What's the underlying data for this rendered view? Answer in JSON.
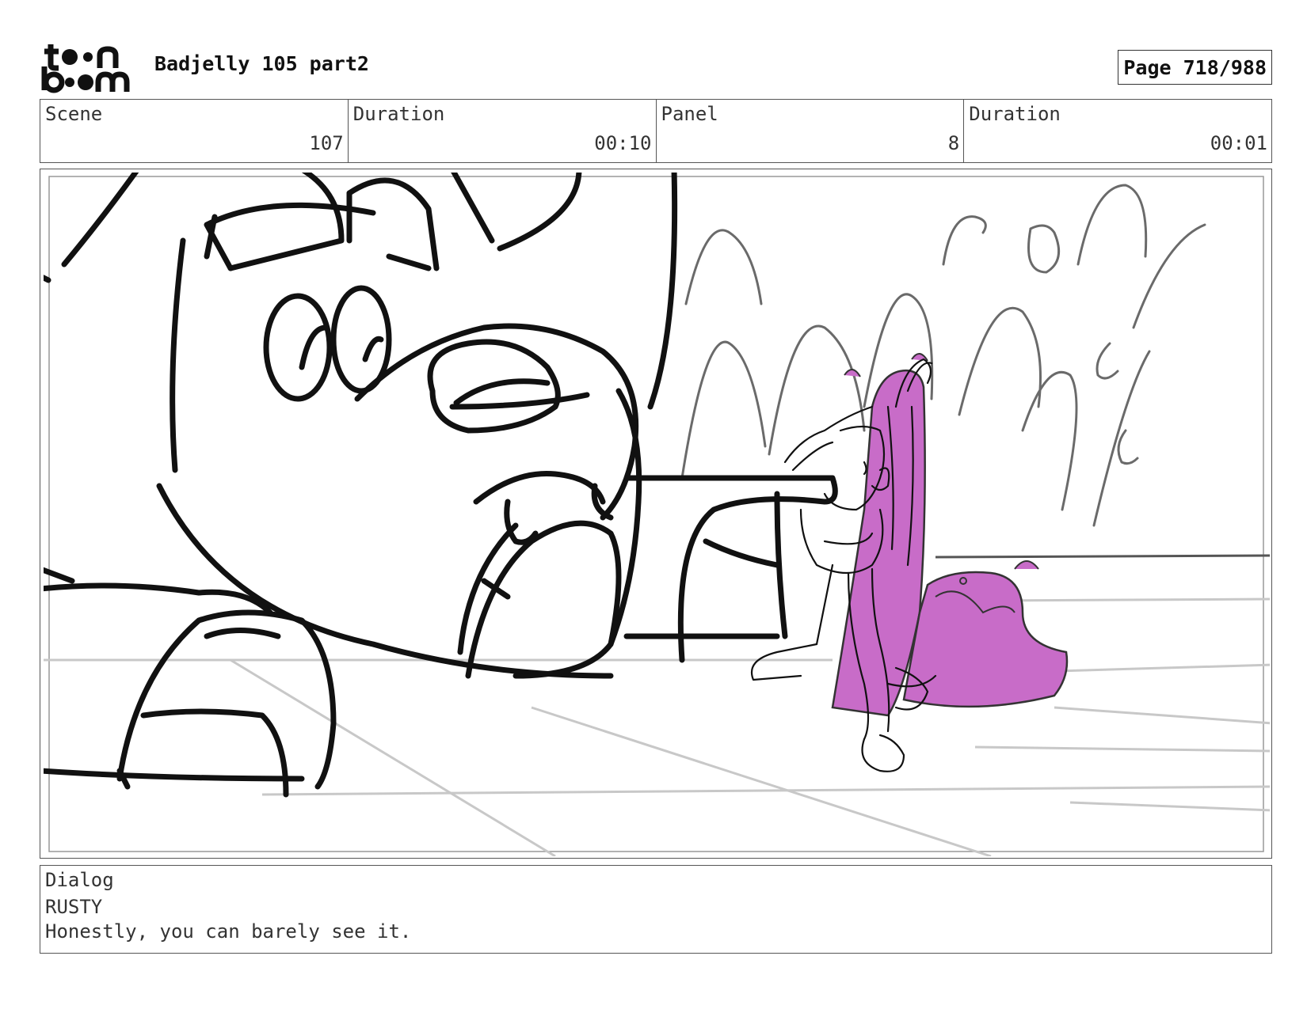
{
  "header": {
    "project_title": "Badjelly 105 part2",
    "page_label": "Page 718/988"
  },
  "info": {
    "scene": {
      "label": "Scene",
      "value": "107"
    },
    "scene_duration": {
      "label": "Duration",
      "value": "00:10"
    },
    "panel": {
      "label": "Panel",
      "value": "8"
    },
    "panel_duration": {
      "label": "Duration",
      "value": "00:01"
    }
  },
  "dialog": {
    "label": "Dialog",
    "speaker": "RUSTY",
    "line": "Honestly, you can barely see it."
  },
  "colors": {
    "ink": "#111111",
    "sketch_gray": "#6a6a6a",
    "floor_gray": "#c8c8c8",
    "magenta_fill": "#c86cc8"
  }
}
